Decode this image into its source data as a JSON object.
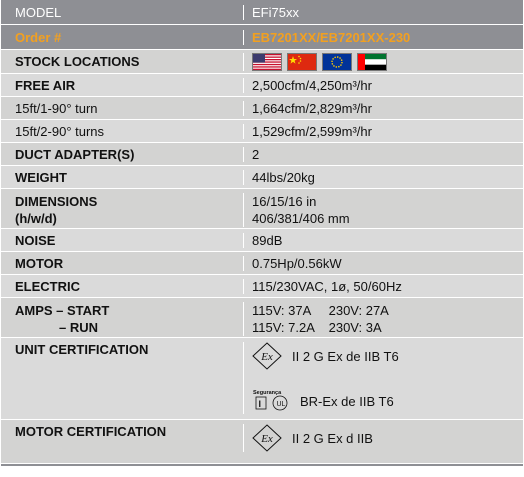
{
  "header": {
    "label": "MODEL",
    "value": "EFi75xx"
  },
  "order": {
    "label": "Order #",
    "value": "EB7201XX/EB7201XX-230"
  },
  "stock": {
    "label": "STOCK LOCATIONS",
    "flags": [
      "us-flag",
      "china-flag",
      "eu-flag",
      "uae-flag"
    ]
  },
  "rows": {
    "free_air": {
      "label": "FREE AIR",
      "value": "2,500cfm/4,250m³/hr"
    },
    "turn1": {
      "label": "15ft/1-90° turn",
      "value": "1,664cfm/2,829m³/hr"
    },
    "turn2": {
      "label": "15ft/2-90° turns",
      "value": "1,529cfm/2,599m³/hr"
    },
    "duct": {
      "label": "DUCT ADAPTER(S)",
      "value": "2"
    },
    "weight": {
      "label": "WEIGHT",
      "value": "44lbs/20kg"
    },
    "dimensions": {
      "label1": "DIMENSIONS",
      "label2": "(h/w/d)",
      "value1": "16/15/16 in",
      "value2": "406/381/406 mm"
    },
    "noise": {
      "label": "NOISE",
      "value": "89dB"
    },
    "motor": {
      "label": "MOTOR",
      "value": "0.75Hp/0.56kW"
    },
    "electric": {
      "label": "ELECTRIC",
      "value": "115/230VAC, 1ø, 50/60Hz"
    },
    "amps": {
      "label1": "AMPS – START",
      "label2": "– RUN",
      "value1": "115V: 37A     230V: 27A",
      "value2": "115V: 7.2A    230V: 3A"
    },
    "unit_cert": {
      "label": "UNIT CERTIFICATION",
      "ex_text": "II 2 G Ex de IIB T6",
      "seg_text": "BR-Ex de IIB T6",
      "seg_logo": "Segurança"
    },
    "motor_cert": {
      "label": "MOTOR CERTIFICATION",
      "ex_text": "II 2 G Ex d IIB"
    }
  }
}
